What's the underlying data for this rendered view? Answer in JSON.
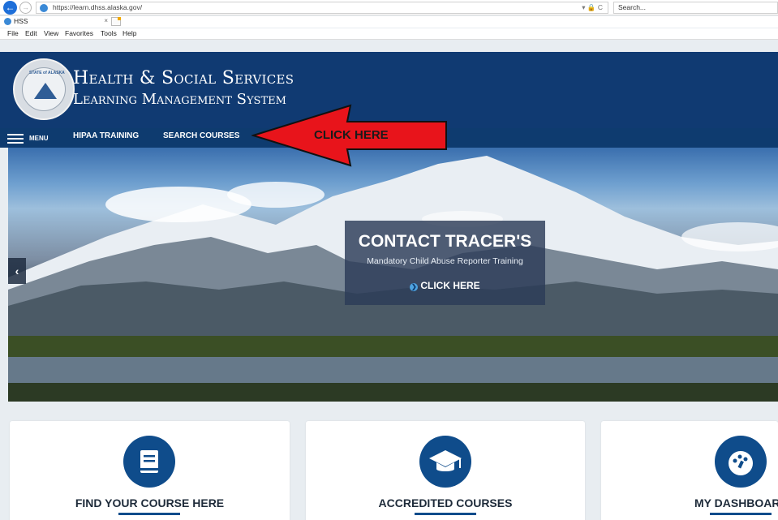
{
  "browser": {
    "url": "https://learn.dhss.alaska.gov/",
    "url_icons": "▾ 🔒 C",
    "search_placeholder": "Search...",
    "tab_title": "HSS",
    "tab_close": "×",
    "menus": [
      "File",
      "Edit",
      "View",
      "Favorites",
      "Tools",
      "Help"
    ]
  },
  "header": {
    "seal_text": "STATE of ALASKA",
    "title": "Health & Social Services",
    "subtitle": "Learning Management System"
  },
  "nav": {
    "menu_label": "MENU",
    "links": [
      "HIPAA TRAINING",
      "SEARCH COURSES"
    ]
  },
  "annotation": {
    "text": "CLICK HERE",
    "color": "#e8141b"
  },
  "hero": {
    "title": "CONTACT TRACER'S",
    "subtitle": "Mandatory Child Abuse Reporter Training",
    "cta": "CLICK HERE",
    "prev_arrow": "‹"
  },
  "cards": [
    {
      "label": "FIND YOUR COURSE HERE",
      "icon": "book-icon"
    },
    {
      "label": "ACCREDITED COURSES",
      "icon": "graduation-cap-icon"
    },
    {
      "label": "MY DASHBOARD",
      "icon": "dashboard-gauge-icon"
    }
  ],
  "colors": {
    "header_bg": "#103a72",
    "nav_bg": "#0e3b6f",
    "accent": "#0f4c8b"
  }
}
